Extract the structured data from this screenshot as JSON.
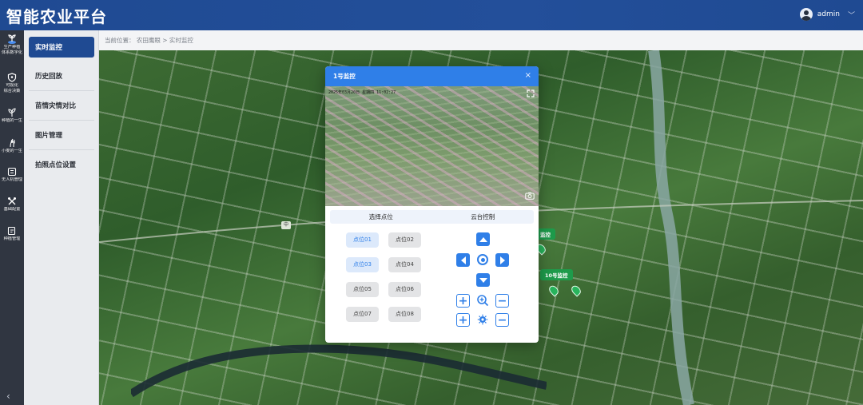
{
  "header": {
    "app_title": "智能农业平台",
    "user_name": "admin"
  },
  "rail": {
    "items": [
      {
        "label": "生产种植\n体系数字化",
        "icon": "plant-icon"
      },
      {
        "label": "可视化\n综合决策",
        "icon": "shield-icon"
      },
      {
        "label": "种植的一生",
        "icon": "sprout-icon"
      },
      {
        "label": "小麦的一生",
        "icon": "wheat-icon"
      },
      {
        "label": "无人机管理",
        "icon": "drone-icon"
      },
      {
        "label": "基础配置",
        "icon": "tools-icon"
      },
      {
        "label": "种植管理",
        "icon": "edit-icon"
      }
    ]
  },
  "subnav": {
    "items": [
      {
        "label": "实时监控",
        "active": true
      },
      {
        "label": "历史回放",
        "active": false
      },
      {
        "label": "苗情灾情对比",
        "active": false
      },
      {
        "label": "图片管理",
        "active": false
      },
      {
        "label": "拍照点位设置",
        "active": false
      }
    ]
  },
  "breadcrumb": {
    "text": "当前位置： 农田鹰眼 > 实时监控"
  },
  "map": {
    "labels": [
      "监控",
      "10号监控"
    ],
    "badge": "中"
  },
  "modal": {
    "title": "1号监控",
    "close": "×",
    "video_stamp": "2025年03月20日 星期四 11:02:27",
    "tabs": [
      "选择点位",
      "云台控制"
    ],
    "points": [
      "点位01",
      "点位02",
      "点位03",
      "点位04",
      "点位05",
      "点位06",
      "点位07",
      "点位08"
    ],
    "selected_points": [
      "点位01",
      "点位03"
    ]
  },
  "colors": {
    "header": "#1f4a92",
    "accent": "#2f7fe8",
    "map_label": "#1e9b4b"
  }
}
